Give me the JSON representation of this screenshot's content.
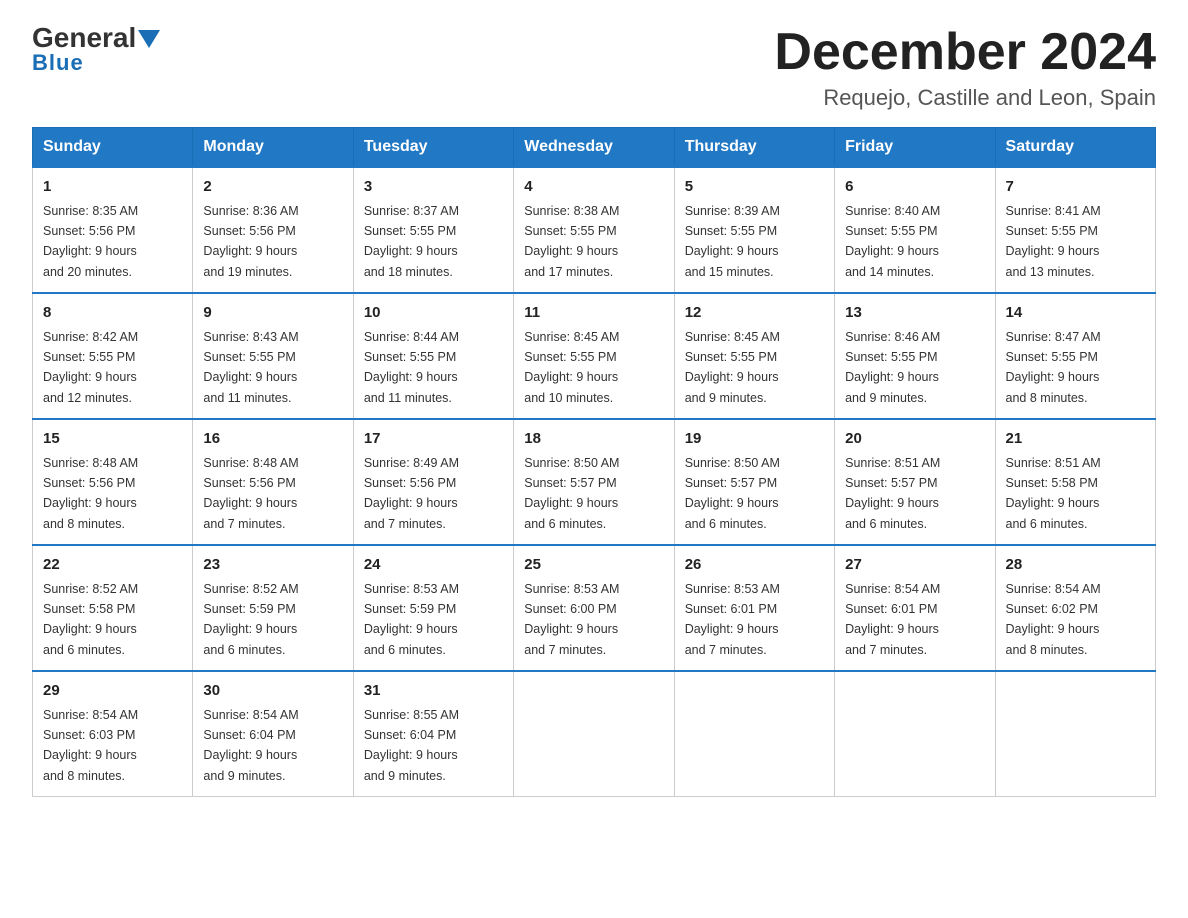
{
  "header": {
    "logo_general": "General",
    "logo_blue": "Blue",
    "month_title": "December 2024",
    "subtitle": "Requejo, Castille and Leon, Spain"
  },
  "days_of_week": [
    "Sunday",
    "Monday",
    "Tuesday",
    "Wednesday",
    "Thursday",
    "Friday",
    "Saturday"
  ],
  "weeks": [
    [
      {
        "day": "1",
        "sunrise": "8:35 AM",
        "sunset": "5:56 PM",
        "daylight": "9 hours and 20 minutes."
      },
      {
        "day": "2",
        "sunrise": "8:36 AM",
        "sunset": "5:56 PM",
        "daylight": "9 hours and 19 minutes."
      },
      {
        "day": "3",
        "sunrise": "8:37 AM",
        "sunset": "5:55 PM",
        "daylight": "9 hours and 18 minutes."
      },
      {
        "day": "4",
        "sunrise": "8:38 AM",
        "sunset": "5:55 PM",
        "daylight": "9 hours and 17 minutes."
      },
      {
        "day": "5",
        "sunrise": "8:39 AM",
        "sunset": "5:55 PM",
        "daylight": "9 hours and 15 minutes."
      },
      {
        "day": "6",
        "sunrise": "8:40 AM",
        "sunset": "5:55 PM",
        "daylight": "9 hours and 14 minutes."
      },
      {
        "day": "7",
        "sunrise": "8:41 AM",
        "sunset": "5:55 PM",
        "daylight": "9 hours and 13 minutes."
      }
    ],
    [
      {
        "day": "8",
        "sunrise": "8:42 AM",
        "sunset": "5:55 PM",
        "daylight": "9 hours and 12 minutes."
      },
      {
        "day": "9",
        "sunrise": "8:43 AM",
        "sunset": "5:55 PM",
        "daylight": "9 hours and 11 minutes."
      },
      {
        "day": "10",
        "sunrise": "8:44 AM",
        "sunset": "5:55 PM",
        "daylight": "9 hours and 11 minutes."
      },
      {
        "day": "11",
        "sunrise": "8:45 AM",
        "sunset": "5:55 PM",
        "daylight": "9 hours and 10 minutes."
      },
      {
        "day": "12",
        "sunrise": "8:45 AM",
        "sunset": "5:55 PM",
        "daylight": "9 hours and 9 minutes."
      },
      {
        "day": "13",
        "sunrise": "8:46 AM",
        "sunset": "5:55 PM",
        "daylight": "9 hours and 9 minutes."
      },
      {
        "day": "14",
        "sunrise": "8:47 AM",
        "sunset": "5:55 PM",
        "daylight": "9 hours and 8 minutes."
      }
    ],
    [
      {
        "day": "15",
        "sunrise": "8:48 AM",
        "sunset": "5:56 PM",
        "daylight": "9 hours and 8 minutes."
      },
      {
        "day": "16",
        "sunrise": "8:48 AM",
        "sunset": "5:56 PM",
        "daylight": "9 hours and 7 minutes."
      },
      {
        "day": "17",
        "sunrise": "8:49 AM",
        "sunset": "5:56 PM",
        "daylight": "9 hours and 7 minutes."
      },
      {
        "day": "18",
        "sunrise": "8:50 AM",
        "sunset": "5:57 PM",
        "daylight": "9 hours and 6 minutes."
      },
      {
        "day": "19",
        "sunrise": "8:50 AM",
        "sunset": "5:57 PM",
        "daylight": "9 hours and 6 minutes."
      },
      {
        "day": "20",
        "sunrise": "8:51 AM",
        "sunset": "5:57 PM",
        "daylight": "9 hours and 6 minutes."
      },
      {
        "day": "21",
        "sunrise": "8:51 AM",
        "sunset": "5:58 PM",
        "daylight": "9 hours and 6 minutes."
      }
    ],
    [
      {
        "day": "22",
        "sunrise": "8:52 AM",
        "sunset": "5:58 PM",
        "daylight": "9 hours and 6 minutes."
      },
      {
        "day": "23",
        "sunrise": "8:52 AM",
        "sunset": "5:59 PM",
        "daylight": "9 hours and 6 minutes."
      },
      {
        "day": "24",
        "sunrise": "8:53 AM",
        "sunset": "5:59 PM",
        "daylight": "9 hours and 6 minutes."
      },
      {
        "day": "25",
        "sunrise": "8:53 AM",
        "sunset": "6:00 PM",
        "daylight": "9 hours and 7 minutes."
      },
      {
        "day": "26",
        "sunrise": "8:53 AM",
        "sunset": "6:01 PM",
        "daylight": "9 hours and 7 minutes."
      },
      {
        "day": "27",
        "sunrise": "8:54 AM",
        "sunset": "6:01 PM",
        "daylight": "9 hours and 7 minutes."
      },
      {
        "day": "28",
        "sunrise": "8:54 AM",
        "sunset": "6:02 PM",
        "daylight": "9 hours and 8 minutes."
      }
    ],
    [
      {
        "day": "29",
        "sunrise": "8:54 AM",
        "sunset": "6:03 PM",
        "daylight": "9 hours and 8 minutes."
      },
      {
        "day": "30",
        "sunrise": "8:54 AM",
        "sunset": "6:04 PM",
        "daylight": "9 hours and 9 minutes."
      },
      {
        "day": "31",
        "sunrise": "8:55 AM",
        "sunset": "6:04 PM",
        "daylight": "9 hours and 9 minutes."
      },
      null,
      null,
      null,
      null
    ]
  ],
  "labels": {
    "sunrise": "Sunrise:",
    "sunset": "Sunset:",
    "daylight": "Daylight:"
  }
}
